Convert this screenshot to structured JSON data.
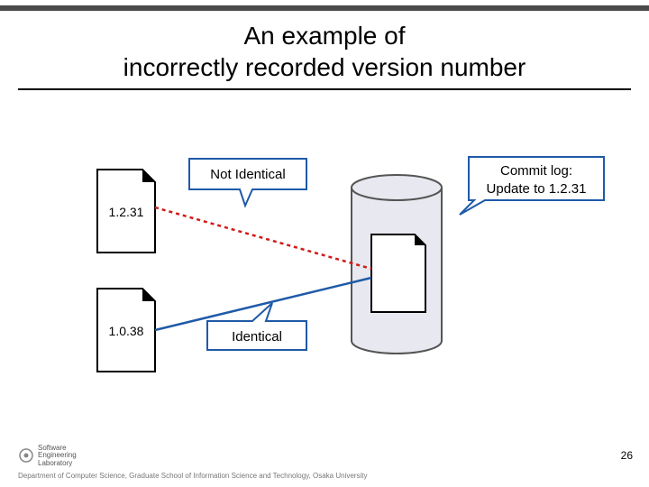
{
  "title_line1": "An example of",
  "title_line2": "incorrectly recorded version number",
  "labels": {
    "not_identical": "Not Identical",
    "identical": "Identical",
    "commit_line1": "Commit log:",
    "commit_line2": "Update to 1.2.31"
  },
  "files": {
    "left_top_version": "1.2.31",
    "left_bottom_version": "1.0.38"
  },
  "footer": "Department of Computer Science, Graduate School of Information Science and Technology, Osaka University",
  "logo": {
    "line1": "Software",
    "line2": "Engineering",
    "line3": "Laboratory"
  },
  "page_number": "26",
  "colors": {
    "callout_border": "#1f5aa8",
    "not_identical_line": "#d11a1a",
    "identical_line": "#1f5aa8",
    "cylinder": "#e8e8f0",
    "cylinder_border": "#555",
    "file_fold": "#000"
  }
}
